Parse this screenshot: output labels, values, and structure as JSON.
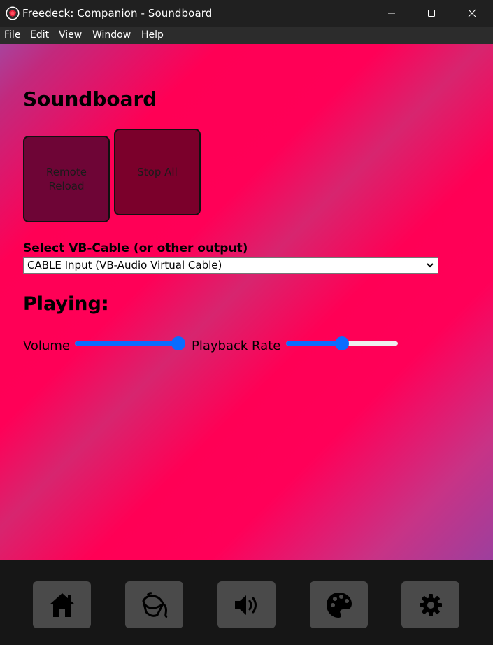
{
  "window": {
    "title": "Freedeck: Companion - Soundboard"
  },
  "menu": {
    "items": [
      "File",
      "Edit",
      "View",
      "Window",
      "Help"
    ]
  },
  "main": {
    "heading": "Soundboard",
    "buttons": [
      {
        "label_line1": "Remote",
        "label_line2": "Reload"
      },
      {
        "label": "Stop All"
      }
    ],
    "output": {
      "label": "Select VB-Cable (or other output)",
      "selected": "CABLE Input (VB-Audio Virtual Cable)"
    },
    "playing_heading": "Playing:",
    "volume": {
      "label": "Volume",
      "value": 1.0
    },
    "playback_rate": {
      "label": "Playback Rate",
      "value": 0.5
    }
  },
  "bottom_nav": {
    "icons": [
      "home-icon",
      "paint-bucket-icon",
      "volume-icon",
      "palette-icon",
      "settings-gear-icon"
    ]
  },
  "colors": {
    "accent_slider": "#0a6cff",
    "gradient_primary": "#ff0055",
    "gradient_secondary": "#a8439d"
  }
}
